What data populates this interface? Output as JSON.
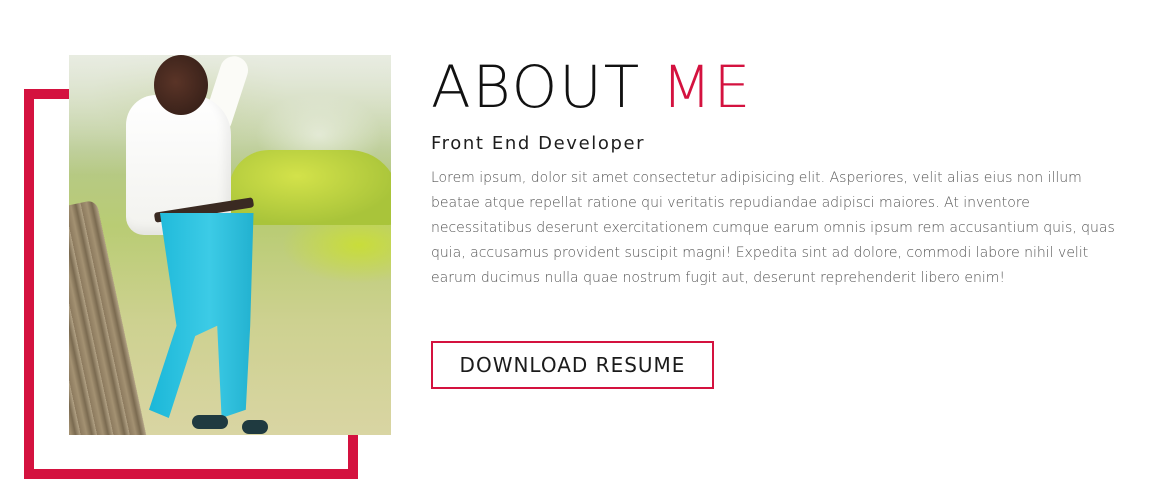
{
  "about": {
    "heading_part1": "ABOUT ",
    "heading_part2": "ME",
    "subtitle": "Front End Developer",
    "description": "Lorem ipsum, dolor sit amet consectetur adipisicing elit. Asperiores, velit alias eius non illum beatae atque repellat ratione qui veritatis repudiandae adipisci maiores. At inventore necessitatibus deserunt exercitationem cumque earum omnis ipsum rem accusantium quis, quas quia, accusamus provident suscipit magni! Expedita sint ad dolore, commodi labore nihil velit earum ducimus nulla quae nostrum fugit aut, deserunt reprehenderit libero enim!",
    "download_label": "DOWNLOAD RESUME"
  },
  "colors": {
    "accent": "#d4123f",
    "heading": "#111111",
    "body_text": "#555555"
  },
  "icons": {
    "frame": "red-bracket-frame"
  }
}
